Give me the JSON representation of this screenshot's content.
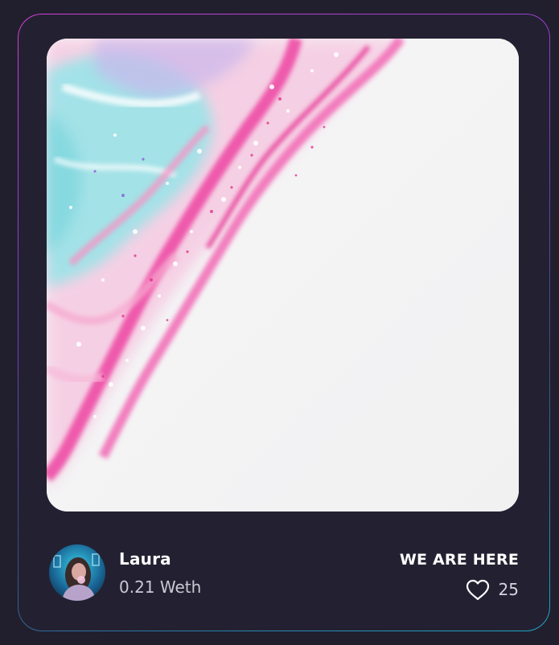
{
  "creator": {
    "name": "Laura",
    "price": "0.21 Weth"
  },
  "item": {
    "title": "WE ARE HERE",
    "likes": "25"
  },
  "icons": {
    "like": "heart-icon"
  },
  "colors": {
    "background": "#211f2d",
    "card": "#232131",
    "border_start": "#d23fd6",
    "border_end": "#1ea7c8",
    "accent_pink": "#ec4fa4",
    "accent_cyan": "#8fe3e3"
  }
}
